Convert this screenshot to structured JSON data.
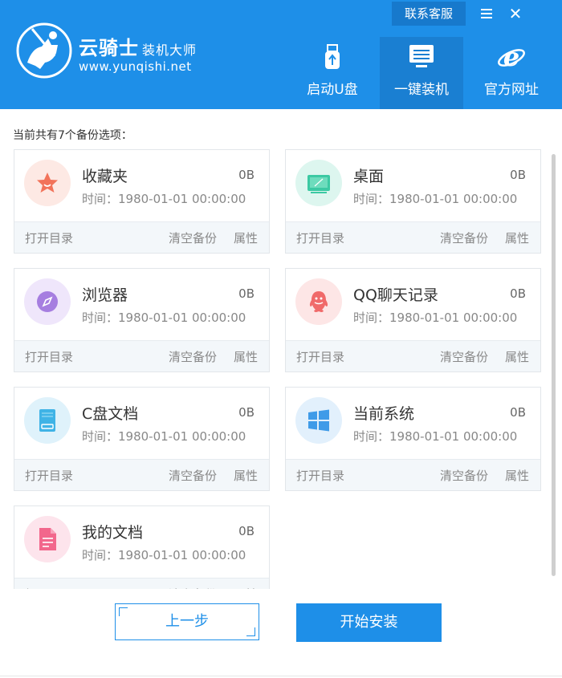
{
  "brand": {
    "name": "云骑士",
    "suffix": "装机大师",
    "url": "www.yunqishi.net"
  },
  "header": {
    "contact": "联系客服"
  },
  "nav": [
    {
      "label": "启动U盘",
      "icon": "usb-drive-icon"
    },
    {
      "label": "一键装机",
      "icon": "monitor-icon",
      "active": true
    },
    {
      "label": "官方网址",
      "icon": "ie-browser-icon"
    }
  ],
  "content": {
    "title": "当前共有7个备份选项："
  },
  "card_actions": {
    "open": "打开目录",
    "clear": "清空备份",
    "properties": "属性"
  },
  "cards": [
    {
      "name": "收藏夹",
      "size": "0B",
      "time": "时间：1980-01-01 00:00:00",
      "icon": "star-icon",
      "color": "#f2735a",
      "bg": "#fde9e4"
    },
    {
      "name": "桌面",
      "size": "0B",
      "time": "时间：1980-01-01 00:00:00",
      "icon": "desktop-icon",
      "color": "#3cc9a3",
      "bg": "#ddf6ef"
    },
    {
      "name": "浏览器",
      "size": "0B",
      "time": "时间：1980-01-01 00:00:00",
      "icon": "compass-icon",
      "color": "#a67ee0",
      "bg": "#efe6fb"
    },
    {
      "name": "QQ聊天记录",
      "size": "0B",
      "time": "时间：1980-01-01 00:00:00",
      "icon": "qq-icon",
      "color": "#f06a6a",
      "bg": "#fde6e6"
    },
    {
      "name": "C盘文档",
      "size": "0B",
      "time": "时间：1980-01-01 00:00:00",
      "icon": "disk-document-icon",
      "color": "#3fb3e6",
      "bg": "#dff2fb"
    },
    {
      "name": "当前系统",
      "size": "0B",
      "time": "时间：1980-01-01 00:00:00",
      "icon": "windows-icon",
      "color": "#3f9be8",
      "bg": "#e2f0fc"
    },
    {
      "name": "我的文档",
      "size": "0B",
      "time": "时间：1980-01-01 00:00:00",
      "icon": "document-icon",
      "color": "#f2678c",
      "bg": "#fde4ec"
    }
  ],
  "buttons": {
    "prev": "上一步",
    "start": "开始安装"
  },
  "colors": {
    "header": "#1e8fe8",
    "active_tab": "#1a7fd2",
    "accent": "#1e8fe8"
  }
}
